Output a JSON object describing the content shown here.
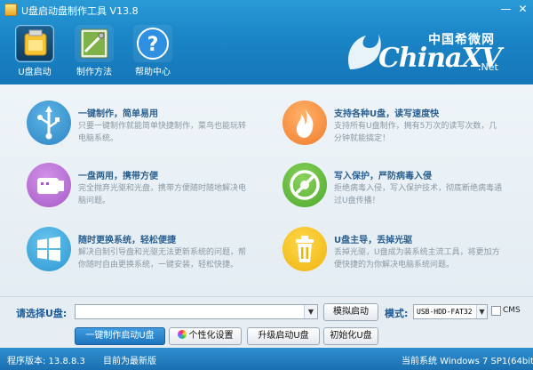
{
  "window": {
    "title": "U盘启动盘制作工具 V13.8",
    "min_label": "—",
    "close_label": "✕"
  },
  "toolbar": [
    {
      "label": "U盘启动",
      "icon": "usb-drive-icon"
    },
    {
      "label": "制作方法",
      "icon": "tools-icon"
    },
    {
      "label": "帮助中心",
      "icon": "help-icon"
    }
  ],
  "logo": {
    "cn": "中国希微网",
    "en": "ChinaXV",
    "net": ".Net"
  },
  "features": [
    {
      "title": "一键制作，简单易用",
      "desc": "只要一键制作就能简单快捷制作，菜鸟也能玩转电脑系统。",
      "icon": "usb-icon",
      "color": "#2b86c6"
    },
    {
      "title": "支持各种U盘，读写速度快",
      "desc": "支持所有U盘制作，拥有5万次的读写次数，几分钟就能搞定！",
      "icon": "flame-icon",
      "color": "#f17b2c"
    },
    {
      "title": "一盘两用，携带方便",
      "desc": "完全抛弃光驱和光盘，携带方便随时随地解决电脑问题。",
      "icon": "usb-stick-icon",
      "color": "#a65ac6"
    },
    {
      "title": "写入保护，严防病毒入侵",
      "desc": "拒绝病毒入侵，写入保护技术，彻底断绝病毒通过U盘传播！",
      "icon": "virus-block-icon",
      "color": "#4da82c"
    },
    {
      "title": "随时更换系统，轻松便捷",
      "desc": "解决自制引导盘和光驱无法更新系统的问题，帮你随时自由更换系统，一键安装，轻松快捷。",
      "icon": "windows-icon",
      "color": "#2c96d2"
    },
    {
      "title": "U盘主导，丢掉光驱",
      "desc": "丢掉光驱，U盘成为装系统主流工具，将更加方便快捷的为你解决电脑系统问题。",
      "icon": "trash-icon",
      "color": "#eeb40e"
    }
  ],
  "panel": {
    "select_label": "请选择U盘:",
    "drive_value": "",
    "simulate_label": "模拟启动",
    "mode_label": "模式:",
    "mode_value": "USB-HDD-FAT32",
    "cms_label": "CMS",
    "make_label": "一键制作启动U盘",
    "personalize_label": "个性化设置",
    "upgrade_label": "升级启动U盘",
    "init_label": "初始化U盘"
  },
  "status": {
    "version": "程序版本: 13.8.8.3",
    "latest": "目前为最新版",
    "system": "当前系统 Windows 7 SP1(64bit)"
  }
}
